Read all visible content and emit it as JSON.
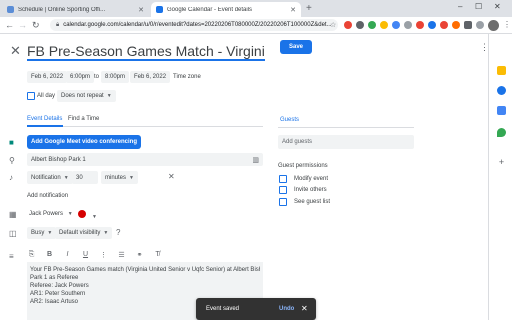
{
  "browser": {
    "tabs": [
      {
        "title": "Schedule | Online Sporting Offi...",
        "active": false,
        "favicon_color": "#5b8dd6"
      },
      {
        "title": "Google Calendar - Event details",
        "active": true,
        "favicon_color": "#1a73e8"
      }
    ],
    "url": "calendar.google.com/calendar/u/0/r/eventedit?dates=20220206T080000Z/20220206T100000Z&det...",
    "new_tab": "+",
    "window_controls": {
      "minimize": "–",
      "maximize": "☐",
      "close": "✕"
    }
  },
  "event": {
    "title": "FB Pre-Season Games Match - Virginia United S",
    "save_label": "Save",
    "start_date": "Feb 6, 2022",
    "start_time": "6:00pm",
    "to_label": "to",
    "end_time": "8:00pm",
    "end_date": "Feb 6, 2022",
    "timezone_label": "Time zone",
    "all_day_label": "All day",
    "repeat_label": "Does not repeat"
  },
  "tabs": {
    "event_details": "Event Details",
    "find_time": "Find a Time"
  },
  "details": {
    "meet_button": "Add Google Meet video conferencing",
    "location": "Albert Bishop Park 1",
    "notification_type": "Notification",
    "notification_value": "30",
    "notification_unit": "minutes",
    "add_notification": "Add notification",
    "owner": "Jack Powers",
    "status": "Busy",
    "visibility": "Default visibility",
    "description_lines": [
      "Your FB Pre-Season Games match (Virginia United Senior v Uqfc Senior) at Albert Bishop",
      "Park 1 as Referee",
      "Referee: Jack Powers",
      "AR1: Peter Southern",
      "AR2: Isaac Artuso"
    ]
  },
  "guests": {
    "tab_label": "Guests",
    "add_placeholder": "Add guests",
    "permissions_title": "Guest permissions",
    "permissions": [
      {
        "label": "Modify event",
        "checked": false
      },
      {
        "label": "Invite others",
        "checked": false
      },
      {
        "label": "See guest list",
        "checked": false
      }
    ]
  },
  "snackbar": {
    "text": "Event saved",
    "undo": "Undo",
    "close": "✕"
  },
  "colors": {
    "accent": "#1a73e8",
    "event_color": "#d50000",
    "chrome_bg": "#dee1e6",
    "field_bg": "#f1f3f4"
  },
  "icons": {
    "close": "close-icon",
    "meet": "video-camera-icon",
    "location": "location-pin-icon",
    "notification": "bell-icon",
    "calendar": "calendar-icon",
    "status": "briefcase-icon",
    "description": "notes-icon"
  }
}
